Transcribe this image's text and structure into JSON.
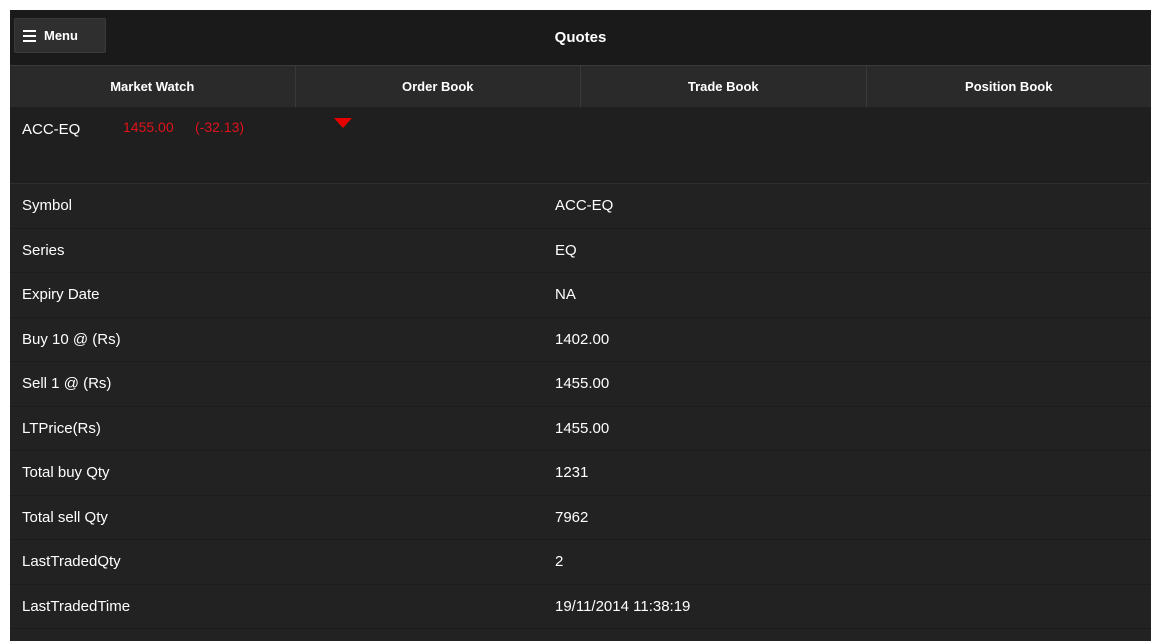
{
  "header": {
    "menu_label": "Menu",
    "title": "Quotes"
  },
  "tabs": [
    {
      "label": "Market Watch"
    },
    {
      "label": "Order Book"
    },
    {
      "label": "Trade Book"
    },
    {
      "label": "Position Book"
    }
  ],
  "ticker": {
    "symbol": "ACC-EQ",
    "price": "1455.00",
    "change": "(-32.13)",
    "direction_icon": "triangle-down-icon",
    "price_color": "#e0121b"
  },
  "rows": [
    {
      "label": "Symbol",
      "value": "ACC-EQ"
    },
    {
      "label": "Series",
      "value": "EQ"
    },
    {
      "label": "Expiry Date",
      "value": "NA"
    },
    {
      "label": "Buy 10 @ (Rs)",
      "value": "1402.00"
    },
    {
      "label": "Sell 1 @ (Rs)",
      "value": "1455.00"
    },
    {
      "label": "LTPrice(Rs)",
      "value": "1455.00"
    },
    {
      "label": "Total buy Qty",
      "value": "1231"
    },
    {
      "label": "Total sell Qty",
      "value": "7962"
    },
    {
      "label": "LastTradedQty",
      "value": "2"
    },
    {
      "label": "LastTradedTime",
      "value": "19/11/2014 11:38:19"
    }
  ]
}
